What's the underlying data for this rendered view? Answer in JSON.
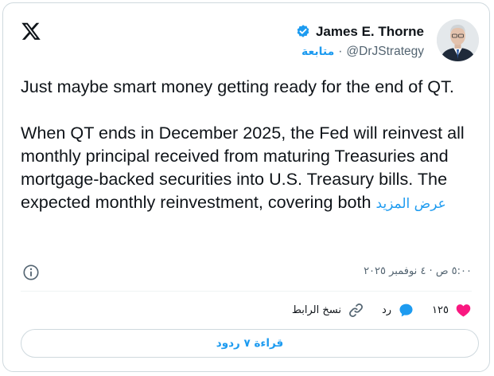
{
  "author": {
    "name": "James E. Thorne",
    "handle": "@DrJStrategy",
    "follow_label": "متابعة",
    "separator": "·"
  },
  "tweet": {
    "text": "Just maybe smart money getting ready for the end of QT.\n\nWhen QT ends in December 2025, the Fed will reinvest all monthly principal received from maturing Treasuries and mortgage-backed securities into U.S. Treasury bills. The expected monthly reinvestment, covering both",
    "show_more": "عرض المزيد",
    "timestamp": "٥:٠٠ ص · ٤ نوفمبر ٢٠٢٥"
  },
  "actions": {
    "like_count": "١٢٥",
    "reply_label": "رد",
    "copy_link_label": "نسخ الرابط"
  },
  "read_replies_label": "قراءة ٧ ردود",
  "colors": {
    "accent": "#1d9bf0",
    "like": "#f91880",
    "text": "#0f1419",
    "muted": "#536471",
    "border": "#cfd9de"
  },
  "icons": [
    "x-logo-icon",
    "verified-badge-icon",
    "info-icon",
    "heart-icon",
    "reply-icon",
    "link-icon"
  ]
}
